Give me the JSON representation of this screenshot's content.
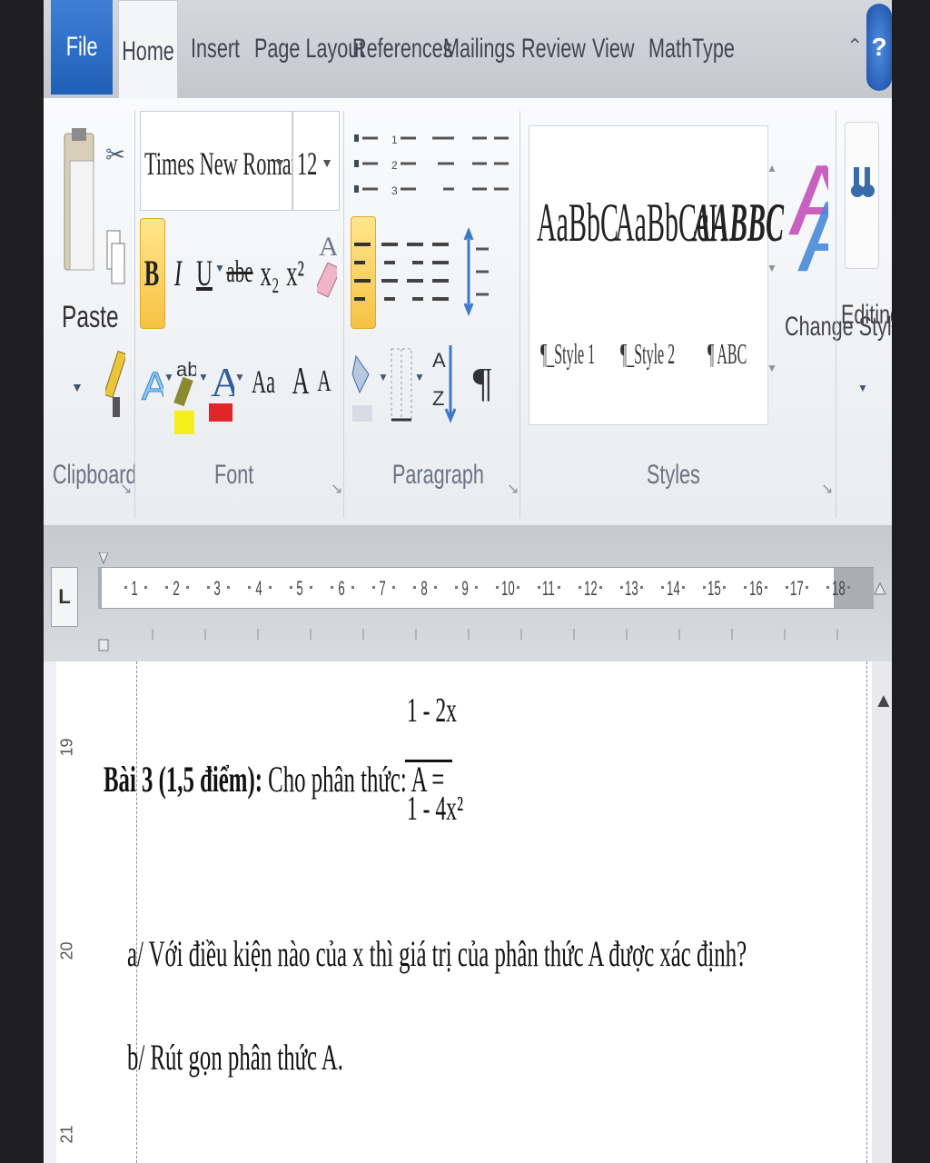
{
  "tabs": {
    "file": "File",
    "home": "Home",
    "items": [
      "Insert",
      "Page Layout",
      "References",
      "Mailings",
      "Review",
      "View",
      "MathType"
    ],
    "help": "?"
  },
  "clipboard": {
    "paste": "Paste",
    "group": "Clipboard"
  },
  "font": {
    "name": "Times New Roman",
    "size": "12",
    "group": "Font",
    "buttons": [
      "B",
      "I",
      "U",
      "abe",
      "x₂",
      "x²"
    ],
    "row3": [
      "Aa",
      "A",
      "A"
    ]
  },
  "paragraph": {
    "group": "Paragraph",
    "pilcrow": "¶"
  },
  "styles": {
    "group": "Styles",
    "items": [
      {
        "preview": "AaBbC",
        "name": "¶_Style 1"
      },
      {
        "preview": "AaBbCcI",
        "name": "¶_Style 2"
      },
      {
        "preview": "AABBC",
        "name": "¶ ABC"
      }
    ],
    "change_styles": "Change Styles",
    "editing": "Editing"
  },
  "ruler": {
    "tab_selector": "L",
    "numbers": [
      "1",
      "2",
      "3",
      "4",
      "5",
      "6",
      "7",
      "8",
      "9",
      "10",
      "11",
      "12",
      "13",
      "14",
      "15",
      "16",
      "17",
      "18"
    ],
    "vertical": [
      "19",
      "20",
      "21"
    ]
  },
  "document": {
    "heading_bold": "Bài 3 (1,5 điểm):",
    "heading_rest": " Cho phân thức: A =",
    "numerator": "1 - 2x",
    "denominator": "1 - 4x²",
    "item_a": "a/  Với điều kiện nào của x thì giá trị của phân thức A được xác định?",
    "item_b": "b/  Rút gọn phân thức A."
  }
}
